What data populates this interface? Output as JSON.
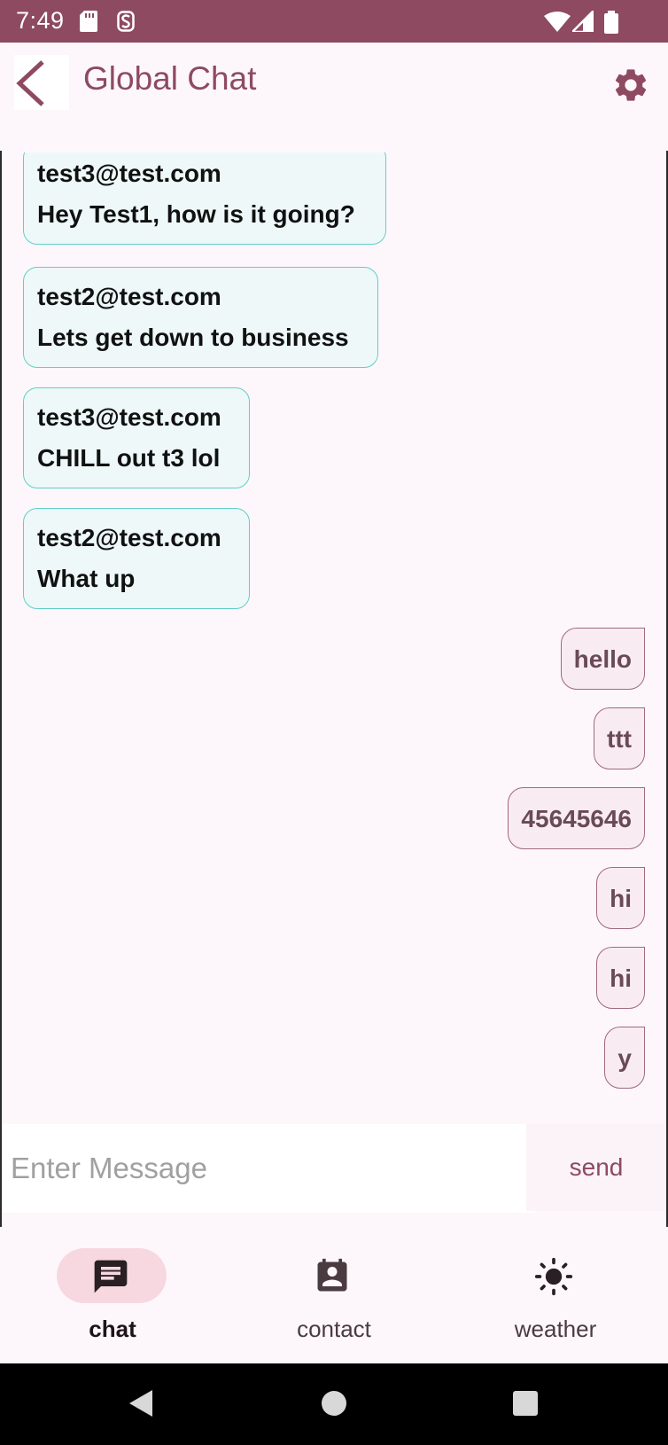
{
  "status_bar": {
    "time": "7:49"
  },
  "app_bar": {
    "title": "Global Chat",
    "back_icon": "back-arrow-icon",
    "settings_icon": "gear-icon"
  },
  "messages_incoming": [
    {
      "sender": "test3@test.com",
      "text": "Hey Test1, how is it going?"
    },
    {
      "sender": "test2@test.com",
      "text": "Lets get down to business"
    },
    {
      "sender": "test3@test.com",
      "text": "CHILL out t3 lol"
    },
    {
      "sender": "test2@test.com",
      "text": "What up"
    }
  ],
  "messages_outgoing": [
    {
      "text": "hello"
    },
    {
      "text": "ttt"
    },
    {
      "text": "45645646"
    },
    {
      "text": "hi"
    },
    {
      "text": "hi"
    },
    {
      "text": "y"
    }
  ],
  "composer": {
    "placeholder": "Enter Message",
    "value": "",
    "send_label": "send"
  },
  "bottom_nav": {
    "items": [
      {
        "label": "chat",
        "icon": "chat-icon",
        "active": true
      },
      {
        "label": "contact",
        "icon": "contact-icon",
        "active": false
      },
      {
        "label": "weather",
        "icon": "sun-icon",
        "active": false
      }
    ]
  },
  "colors": {
    "primary": "#8e4a60",
    "incoming_bubble": "#eef8f8",
    "incoming_border": "#5fd0c8",
    "outgoing_bubble": "#f8ecf2",
    "outgoing_border": "#a0697e",
    "nav_active_pill": "#f7d8e0",
    "background": "#fdf7fb"
  }
}
